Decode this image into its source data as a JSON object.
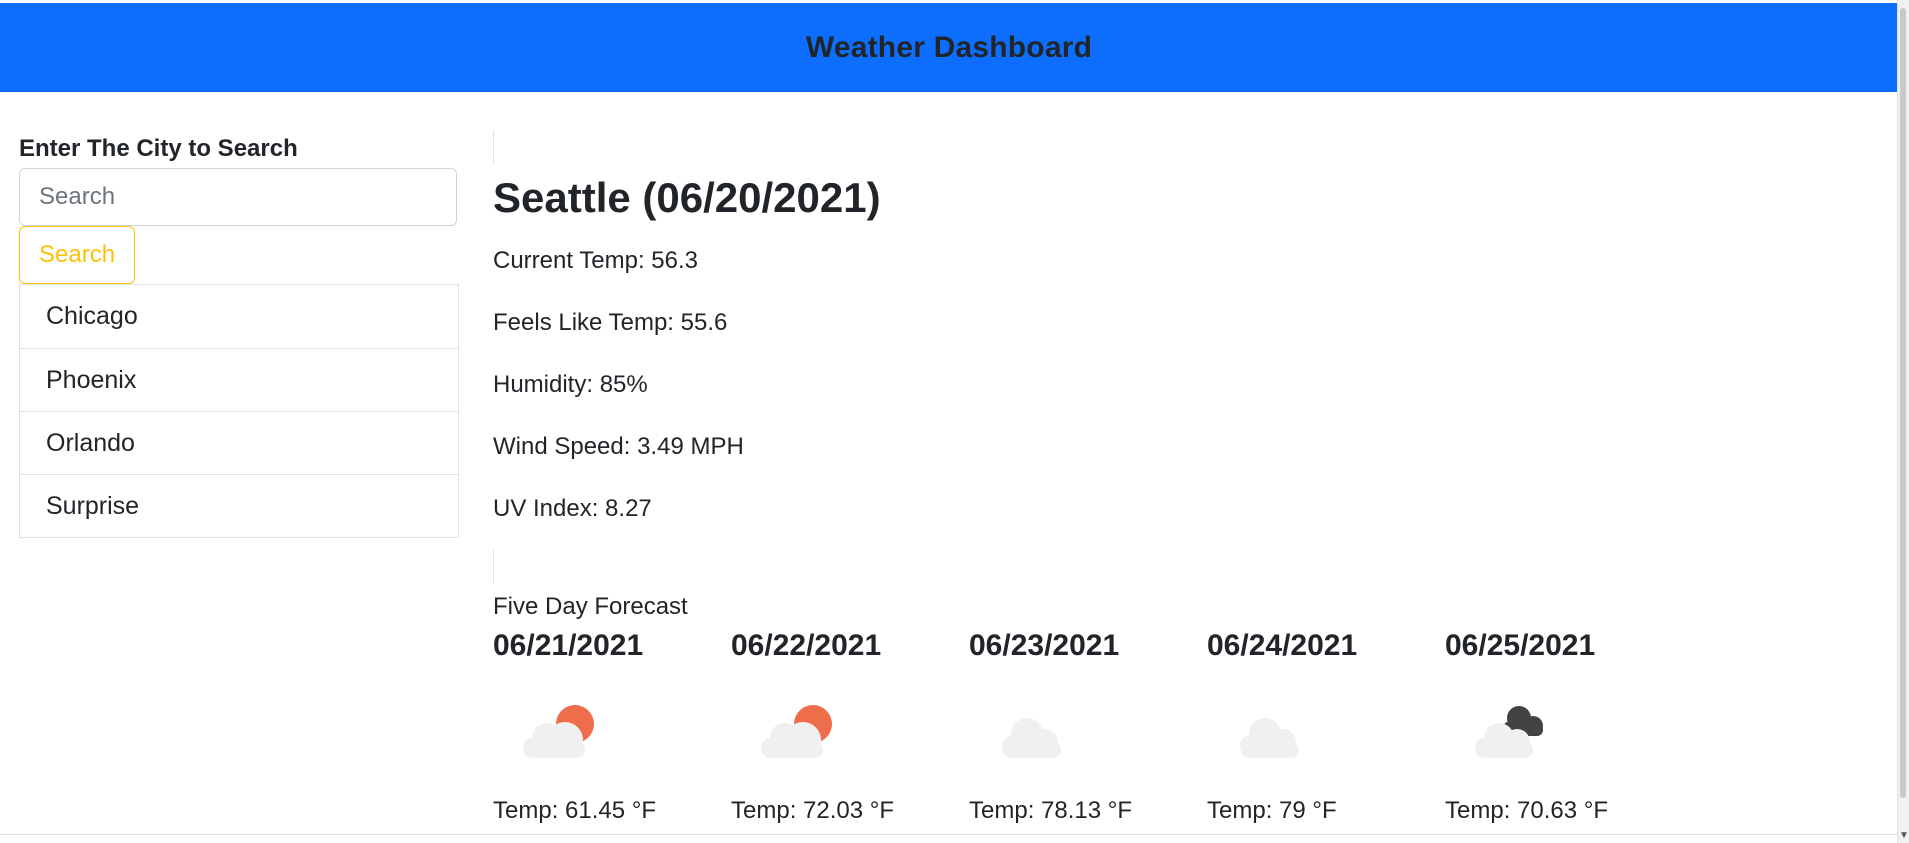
{
  "header": {
    "title": "Weather Dashboard"
  },
  "sidebar": {
    "label": "Enter The City to Search",
    "search_placeholder": "Search",
    "search_button": "Search",
    "cities": [
      "Chicago",
      "Phoenix",
      "Orlando",
      "Surprise"
    ]
  },
  "current": {
    "title": "Seattle (06/20/2021)",
    "temp": "Current Temp: 56.3",
    "feels_like": "Feels Like Temp: 55.6",
    "humidity": "Humidity: 85%",
    "wind": "Wind Speed: 3.49 MPH",
    "uv": "UV Index: 8.27"
  },
  "forecast": {
    "heading": "Five Day Forecast",
    "days": [
      {
        "date": "06/21/2021",
        "icon": "partly-cloudy-day-icon",
        "temp": "Temp: 61.45 °F"
      },
      {
        "date": "06/22/2021",
        "icon": "partly-cloudy-day-icon",
        "temp": "Temp: 72.03 °F"
      },
      {
        "date": "06/23/2021",
        "icon": "cloud-icon",
        "temp": "Temp: 78.13 °F"
      },
      {
        "date": "06/24/2021",
        "icon": "cloud-icon",
        "temp": "Temp: 79 °F"
      },
      {
        "date": "06/25/2021",
        "icon": "broken-clouds-icon",
        "temp": "Temp: 70.63 °F"
      }
    ]
  },
  "colors": {
    "header_bg": "#0d6efd",
    "search_button": "#ffc107",
    "sun": "#ee6e4b",
    "cloud_light": "#f0f0f0",
    "cloud_dark": "#424242"
  }
}
